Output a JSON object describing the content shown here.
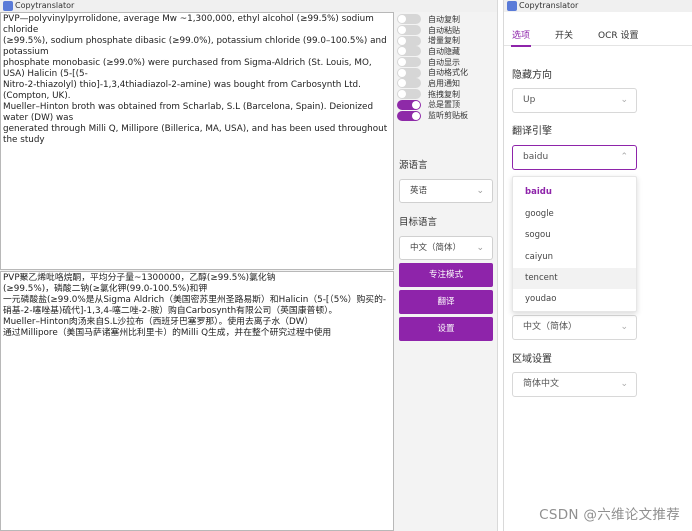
{
  "left_window": {
    "title": "Copytranslator",
    "source_lines": [
      "PVP—polyvinylpyrrolidone, average Mw ~1,300,000, ethyl alcohol (≥99.5%) sodium chloride",
      "(≥99.5%), sodium phosphate dibasic (≥99.0%), potassium chloride (99.0–100.5%) and potassium",
      "phosphate monobasic (≥99.0%) were purchased from Sigma-Aldrich (St. Louis, MO, USA) Halicin (5-[(5-",
      "Nitro-2-thiazolyl) thio]-1,3,4thiadiazol-2-amine) was bought from Carbosynth Ltd. (Compton, UK).",
      "Mueller–Hinton broth was obtained from Scharlab, S.L (Barcelona, Spain). Deionized water (DW) was",
      "generated through Milli Q, Millipore (Billerica, MA, USA), and has been used throughout the study"
    ],
    "translation_lines": [
      "PVP聚乙烯吡咯烷酮，平均分子量~1300000，乙醇(≥99.5%)氯化钠",
      "(≥99.5%)，磷酸二钠(≥氯化钾(99.0-100.5%)和钾",
      "一元磷酸盐(≥99.0%是从Sigma Aldrich（美国密苏里州圣路易斯）和Halicin（5-[（5%）购买的-",
      "硝基-2-噻唑基)硫代]-1,3,4-噻二唑-2-胺）购自Carbosynth有限公司（英国康普顿）。",
      "Mueller–Hinton肉汤来自S.L沙拉布（西班牙巴塞罗那）。使用去离子水（DW）",
      "通过Millipore（美国马萨诸塞州比利里卡）的Milli Q生成，并在整个研究过程中使用"
    ],
    "toggles": [
      {
        "label": "自动复制",
        "on": false
      },
      {
        "label": "自动粘贴",
        "on": false
      },
      {
        "label": "增量复制",
        "on": false
      },
      {
        "label": "自动隐藏",
        "on": false
      },
      {
        "label": "自动显示",
        "on": false
      },
      {
        "label": "自动格式化",
        "on": false
      },
      {
        "label": "启用通知",
        "on": false
      },
      {
        "label": "拖拽复制",
        "on": false
      },
      {
        "label": "总是置顶",
        "on": true
      },
      {
        "label": "监听剪贴板",
        "on": true
      }
    ],
    "source_language_label": "源语言",
    "source_language_value": "英语",
    "target_language_label": "目标语言",
    "target_language_value": "中文（简体）",
    "focus_mode_button": "专注模式",
    "translate_button": "翻译",
    "settings_button": "设置"
  },
  "right_window": {
    "title": "Copytranslator",
    "tabs": [
      "选项",
      "开关",
      "OCR 设置"
    ],
    "hide_direction_label": "隐藏方向",
    "hide_direction_value": "Up",
    "engine_label": "翻译引擎",
    "engine_value": "baidu",
    "engine_options": [
      "baidu",
      "google",
      "sogou",
      "caiyun",
      "tencent",
      "youdao"
    ],
    "hidden_select_value": "中文（简体）",
    "region_label": "区域设置",
    "region_value": "简体中文"
  },
  "watermark": "CSDN @六维论文推荐",
  "colors": {
    "accent": "#8e24aa",
    "toggle_off": "#d6d6d6"
  },
  "icons": {
    "chevron": "chevron-down-icon",
    "chevron_up": "chevron-up-icon"
  }
}
